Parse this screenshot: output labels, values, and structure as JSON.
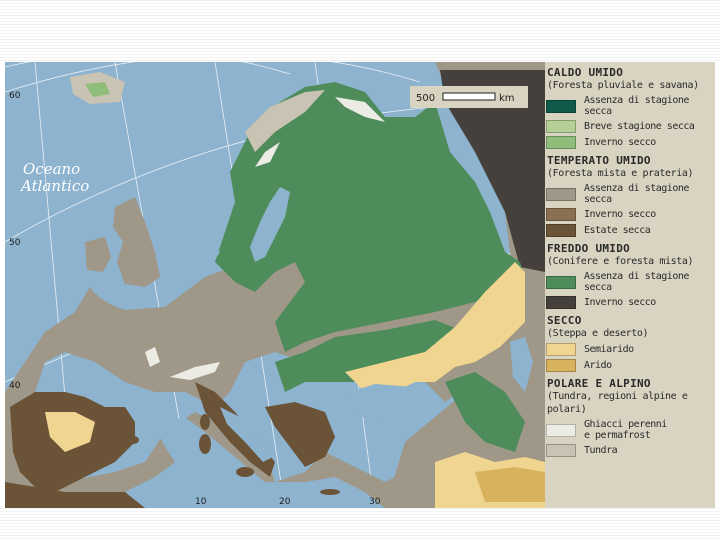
{
  "map": {
    "ocean_label_line1": "Oceano",
    "ocean_label_line2": "Atlantico",
    "scale_value": "500",
    "scale_unit": "km",
    "latitude_labels": [
      "60",
      "50",
      "40"
    ],
    "longitude_labels": [
      "10",
      "20",
      "30"
    ]
  },
  "legend": {
    "groups": [
      {
        "title": "CALDO UMIDO",
        "subtitle": "(Foresta pluviale e savana)",
        "items": [
          {
            "label": "Assenza di stagione secca",
            "color": "#0f5a4a"
          },
          {
            "label": "Breve stagione secca",
            "color": "#b5cf97"
          },
          {
            "label": "Inverno secco",
            "color": "#8fbd7a"
          }
        ]
      },
      {
        "title": "TEMPERATO UMIDO",
        "subtitle": "(Foresta mista e prateria)",
        "items": [
          {
            "label": "Assenza di stagione secca",
            "color": "#9f9787"
          },
          {
            "label": "Inverno secco",
            "color": "#8a7050"
          },
          {
            "label": "Estate secca",
            "color": "#6b5338"
          }
        ]
      },
      {
        "title": "FREDDO UMIDO",
        "subtitle": "(Conifere e foresta mista)",
        "items": [
          {
            "label": "Assenza di stagione secca",
            "color": "#4e8d5b"
          },
          {
            "label": "Inverno secco",
            "color": "#45403b"
          }
        ]
      },
      {
        "title": "SECCO",
        "subtitle": "(Steppa e deserto)",
        "items": [
          {
            "label": "Semiarido",
            "color": "#efd590"
          },
          {
            "label": "Arido",
            "color": "#d9b25e"
          }
        ]
      },
      {
        "title": "POLARE E ALPINO",
        "subtitle": "(Tundra, regioni alpine e polari)",
        "items": [
          {
            "label": "Ghiacci perenni\ne permafrost",
            "color": "#ecece4"
          },
          {
            "label": "Tundra",
            "color": "#c9c3b3"
          }
        ]
      }
    ]
  }
}
